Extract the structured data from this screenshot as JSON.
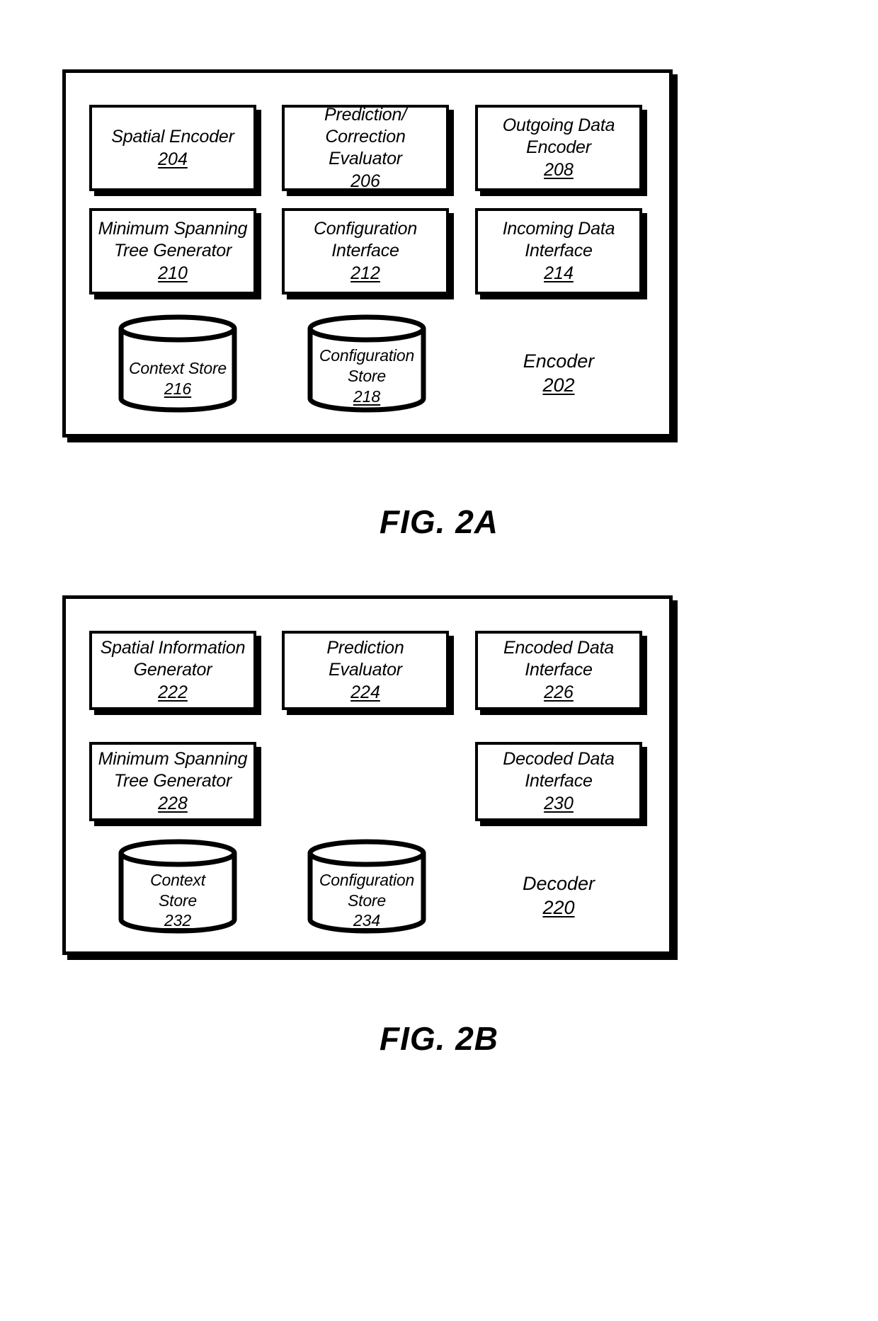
{
  "figures": [
    {
      "id": "fig-2a",
      "caption": "FIG. 2A",
      "container_label": {
        "name": "Encoder",
        "number": "202"
      },
      "modules": [
        {
          "name": "Spatial Encoder",
          "number": "204"
        },
        {
          "name": "Prediction/\nCorrection\nEvaluator",
          "number": "206"
        },
        {
          "name": "Outgoing Data\nEncoder",
          "number": "208"
        },
        {
          "name": "Minimum Spanning\nTree Generator",
          "number": "210"
        },
        {
          "name": "Configuration\nInterface",
          "number": "212"
        },
        {
          "name": "Incoming Data\nInterface",
          "number": "214"
        }
      ],
      "stores": [
        {
          "name": "Context Store",
          "number": "216"
        },
        {
          "name": "Configuration\nStore",
          "number": "218"
        }
      ]
    },
    {
      "id": "fig-2b",
      "caption": "FIG. 2B",
      "container_label": {
        "name": "Decoder",
        "number": "220"
      },
      "modules": [
        {
          "name": "Spatial Information\nGenerator",
          "number": "222"
        },
        {
          "name": "Prediction\nEvaluator",
          "number": "224"
        },
        {
          "name": "Encoded Data\nInterface",
          "number": "226"
        },
        {
          "name": "Minimum Spanning\nTree Generator",
          "number": "228"
        },
        {
          "name": "Decoded Data\nInterface",
          "number": "230"
        }
      ],
      "stores": [
        {
          "name": "Context\nStore",
          "number": "232"
        },
        {
          "name": "Configuration\nStore",
          "number": "234"
        }
      ]
    }
  ],
  "colors": {
    "ink": "#000000",
    "paper": "#ffffff"
  }
}
